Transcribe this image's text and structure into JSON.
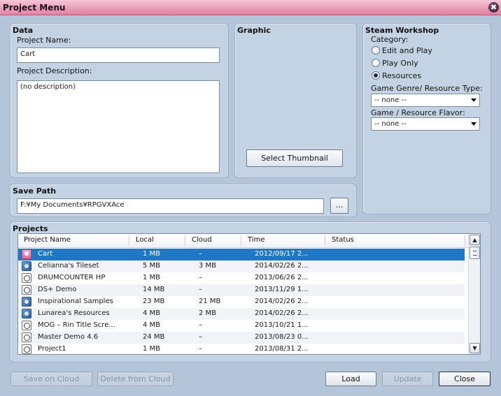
{
  "window": {
    "title": "Project Menu",
    "close_glyph": "✖"
  },
  "data_panel": {
    "title": "Data",
    "project_name_label": "Project Name:",
    "project_name_value": "Cart",
    "project_description_label": "Project Description:",
    "project_description_value": "(no description)"
  },
  "graphic_panel": {
    "title": "Graphic",
    "select_thumbnail_label": "Select Thumbnail"
  },
  "steam_panel": {
    "title": "Steam Workshop",
    "category_label": "Category:",
    "categories": [
      {
        "label": "Edit and Play",
        "checked": false
      },
      {
        "label": "Play Only",
        "checked": false
      },
      {
        "label": "Resources",
        "checked": true
      }
    ],
    "genre_label": "Game Genre/ Resource Type:",
    "genre_value": "-- none --",
    "flavor_label": "Game / Resource Flavor:",
    "flavor_value": "-- none --"
  },
  "save_path": {
    "title": "Save Path",
    "value": "F:¥My Documents¥RPGVXAce",
    "browse_label": "..."
  },
  "projects": {
    "title": "Projects",
    "columns": [
      "Project Name",
      "Local",
      "Cloud",
      "Time",
      "Status"
    ],
    "rows": [
      {
        "icon": "pink-project-icon",
        "name": "Cart",
        "local": "1 MB",
        "cloud": "–",
        "time": "2012/09/17 2...",
        "status": ""
      },
      {
        "icon": "resource-icon",
        "name": "Celianna's Tileset",
        "local": "5 MB",
        "cloud": "3 MB",
        "time": "2014/02/26 2...",
        "status": ""
      },
      {
        "icon": "project-icon",
        "name": "DRUMCOUNTER HP",
        "local": "1 MB",
        "cloud": "–",
        "time": "2013/06/26 2...",
        "status": ""
      },
      {
        "icon": "project-icon",
        "name": "DS+ Demo",
        "local": "14 MB",
        "cloud": "–",
        "time": "2013/11/29 1...",
        "status": ""
      },
      {
        "icon": "resource-icon",
        "name": "Inspirational Samples",
        "local": "23 MB",
        "cloud": "21 MB",
        "time": "2014/02/26 2...",
        "status": ""
      },
      {
        "icon": "resource-icon",
        "name": "Lunarea's Resources",
        "local": "4 MB",
        "cloud": "2 MB",
        "time": "2014/02/26 2...",
        "status": ""
      },
      {
        "icon": "project-icon",
        "name": "MOG – Rin Title Scre...",
        "local": "4 MB",
        "cloud": "–",
        "time": "2013/10/21 1...",
        "status": ""
      },
      {
        "icon": "project-icon",
        "name": "Master  Demo 4.6",
        "local": "24 MB",
        "cloud": "–",
        "time": "2013/08/23 0...",
        "status": ""
      },
      {
        "icon": "project-icon",
        "name": "Project1",
        "local": "1 MB",
        "cloud": "–",
        "time": "2013/08/31 2...",
        "status": ""
      }
    ],
    "selected_index": 0
  },
  "footer": {
    "save_on_cloud": "Save on Cloud",
    "delete_from_cloud": "Delete from Cloud",
    "load": "Load",
    "update": "Update",
    "close": "Close"
  }
}
